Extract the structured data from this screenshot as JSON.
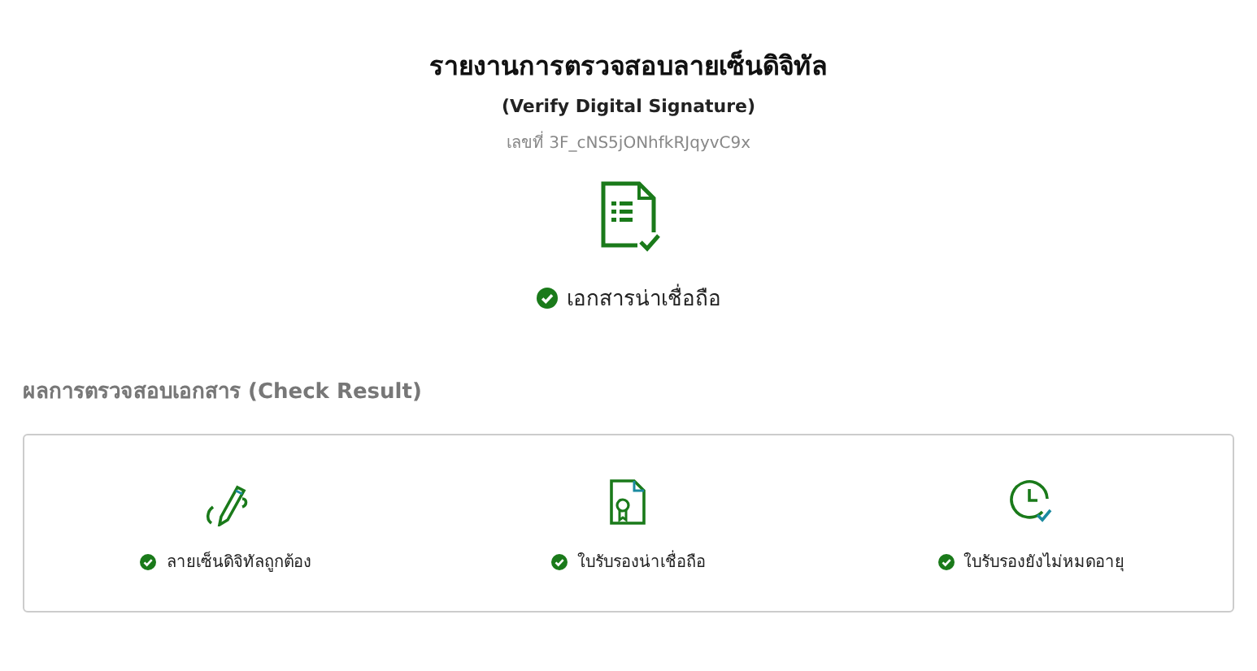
{
  "report": {
    "title": "รายงานการตรวจสอบลายเซ็นดิจิทัล",
    "subtitle": "(Verify Digital Signature)",
    "number": "เลขที่ 3F_cNS5jONhfkRJqyvC9x",
    "status": {
      "label": "เอกสารน่าเชื่อถือ",
      "ok": true
    }
  },
  "check_result": {
    "heading": "ผลการตรวจสอบเอกสาร (Check Result)",
    "items": [
      {
        "kind": "signature",
        "label": "ลายเซ็นดิจิทัลถูกต้อง",
        "ok": true
      },
      {
        "kind": "certificate",
        "label": "ใบรับรองน่าเชื่อถือ",
        "ok": true
      },
      {
        "kind": "clock",
        "label": "ใบรับรองยังไม่หมดอายุ",
        "ok": true
      }
    ]
  }
}
